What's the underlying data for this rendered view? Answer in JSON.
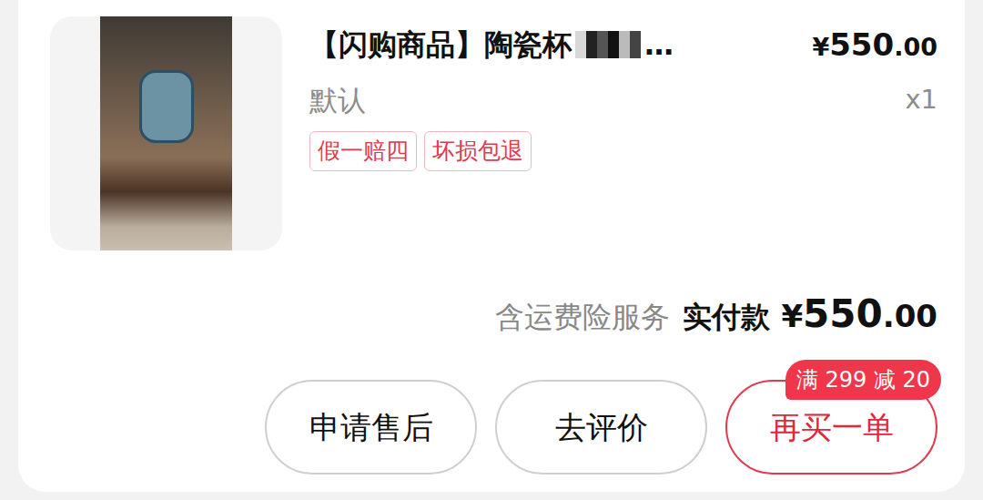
{
  "product": {
    "title": "【闪购商品】陶瓷杯",
    "title_ellipsis": "…",
    "price": {
      "currency": "¥",
      "integer": "550",
      "decimal": ".00"
    },
    "variant": "默认",
    "quantity": "x1",
    "tags": [
      "假一赔四",
      "坏损包退"
    ]
  },
  "summary": {
    "service": "含运费险服务",
    "label": "实付款",
    "amount": {
      "currency": "¥",
      "integer": "550",
      "decimal": ".00"
    }
  },
  "buttons": [
    {
      "label": "申请售后",
      "kind": "plain"
    },
    {
      "label": "去评价",
      "kind": "plain"
    },
    {
      "label": "再买一单",
      "kind": "primary",
      "badge": "满 299 减 20"
    }
  ]
}
